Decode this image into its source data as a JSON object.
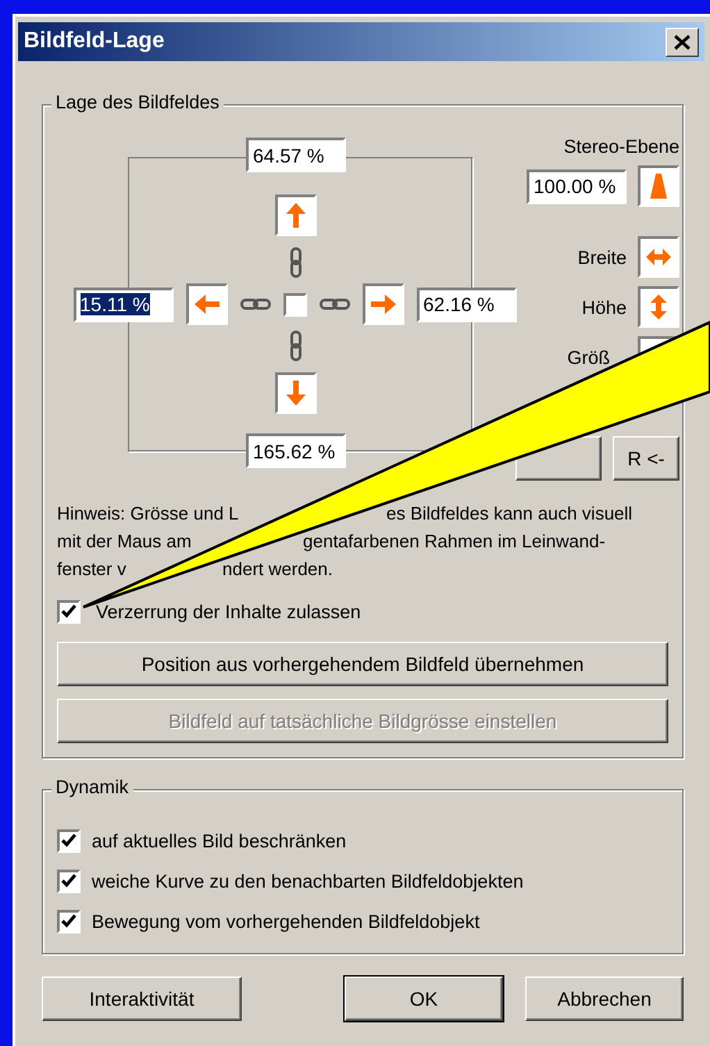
{
  "window": {
    "title": "Bildfeld-Lage"
  },
  "position_group": {
    "title": "Lage des Bildfeldes",
    "top": {
      "value": "64.57 %",
      "selected": false
    },
    "left": {
      "value": "15.11 %",
      "selected": true
    },
    "right": {
      "value": "62.16 %",
      "selected": false
    },
    "bottom": {
      "value": "165.62 %",
      "selected": false
    },
    "center_checkbox": {
      "checked": false
    },
    "stereo_label": "Stereo-Ebene",
    "stereo_value": "100.00 %",
    "size_rows": [
      {
        "label": "Breite",
        "kind": "width"
      },
      {
        "label": "Höhe",
        "kind": "height"
      },
      {
        "label": "Größ",
        "kind": "covered"
      }
    ],
    "reset_button": "R <-",
    "hint_lines": [
      {
        "left": "Hinweis: Grösse und L",
        "right": "es Bildfeldes kann auch visuell"
      },
      {
        "left": "mit der Maus am",
        "right": "gentafarbenen Rahmen im Leinwand-"
      },
      {
        "left": "fenster v",
        "right": "ndert werden."
      }
    ],
    "distortion": {
      "label": "Verzerrung der Inhalte zulassen",
      "checked": true
    },
    "buttons": [
      {
        "label": "Position aus vorhergehendem Bildfeld übernehmen",
        "disabled": false
      },
      {
        "label": "Bildfeld auf tatsächliche Bildgrösse einstellen",
        "disabled": true
      }
    ]
  },
  "dynamics_group": {
    "title": "Dynamik",
    "options": [
      {
        "label": "auf aktuelles Bild beschränken",
        "checked": true
      },
      {
        "label": "weiche Kurve zu den benachbarten Bildfeldobjekten",
        "checked": true
      },
      {
        "label": "Bewegung vom vorhergehenden Bildfeldobjekt",
        "checked": true
      }
    ]
  },
  "footer_buttons": [
    {
      "label": "Interaktivität",
      "default": false
    },
    {
      "label": "OK",
      "default": true
    },
    {
      "label": "Abbrechen",
      "default": false
    }
  ]
}
